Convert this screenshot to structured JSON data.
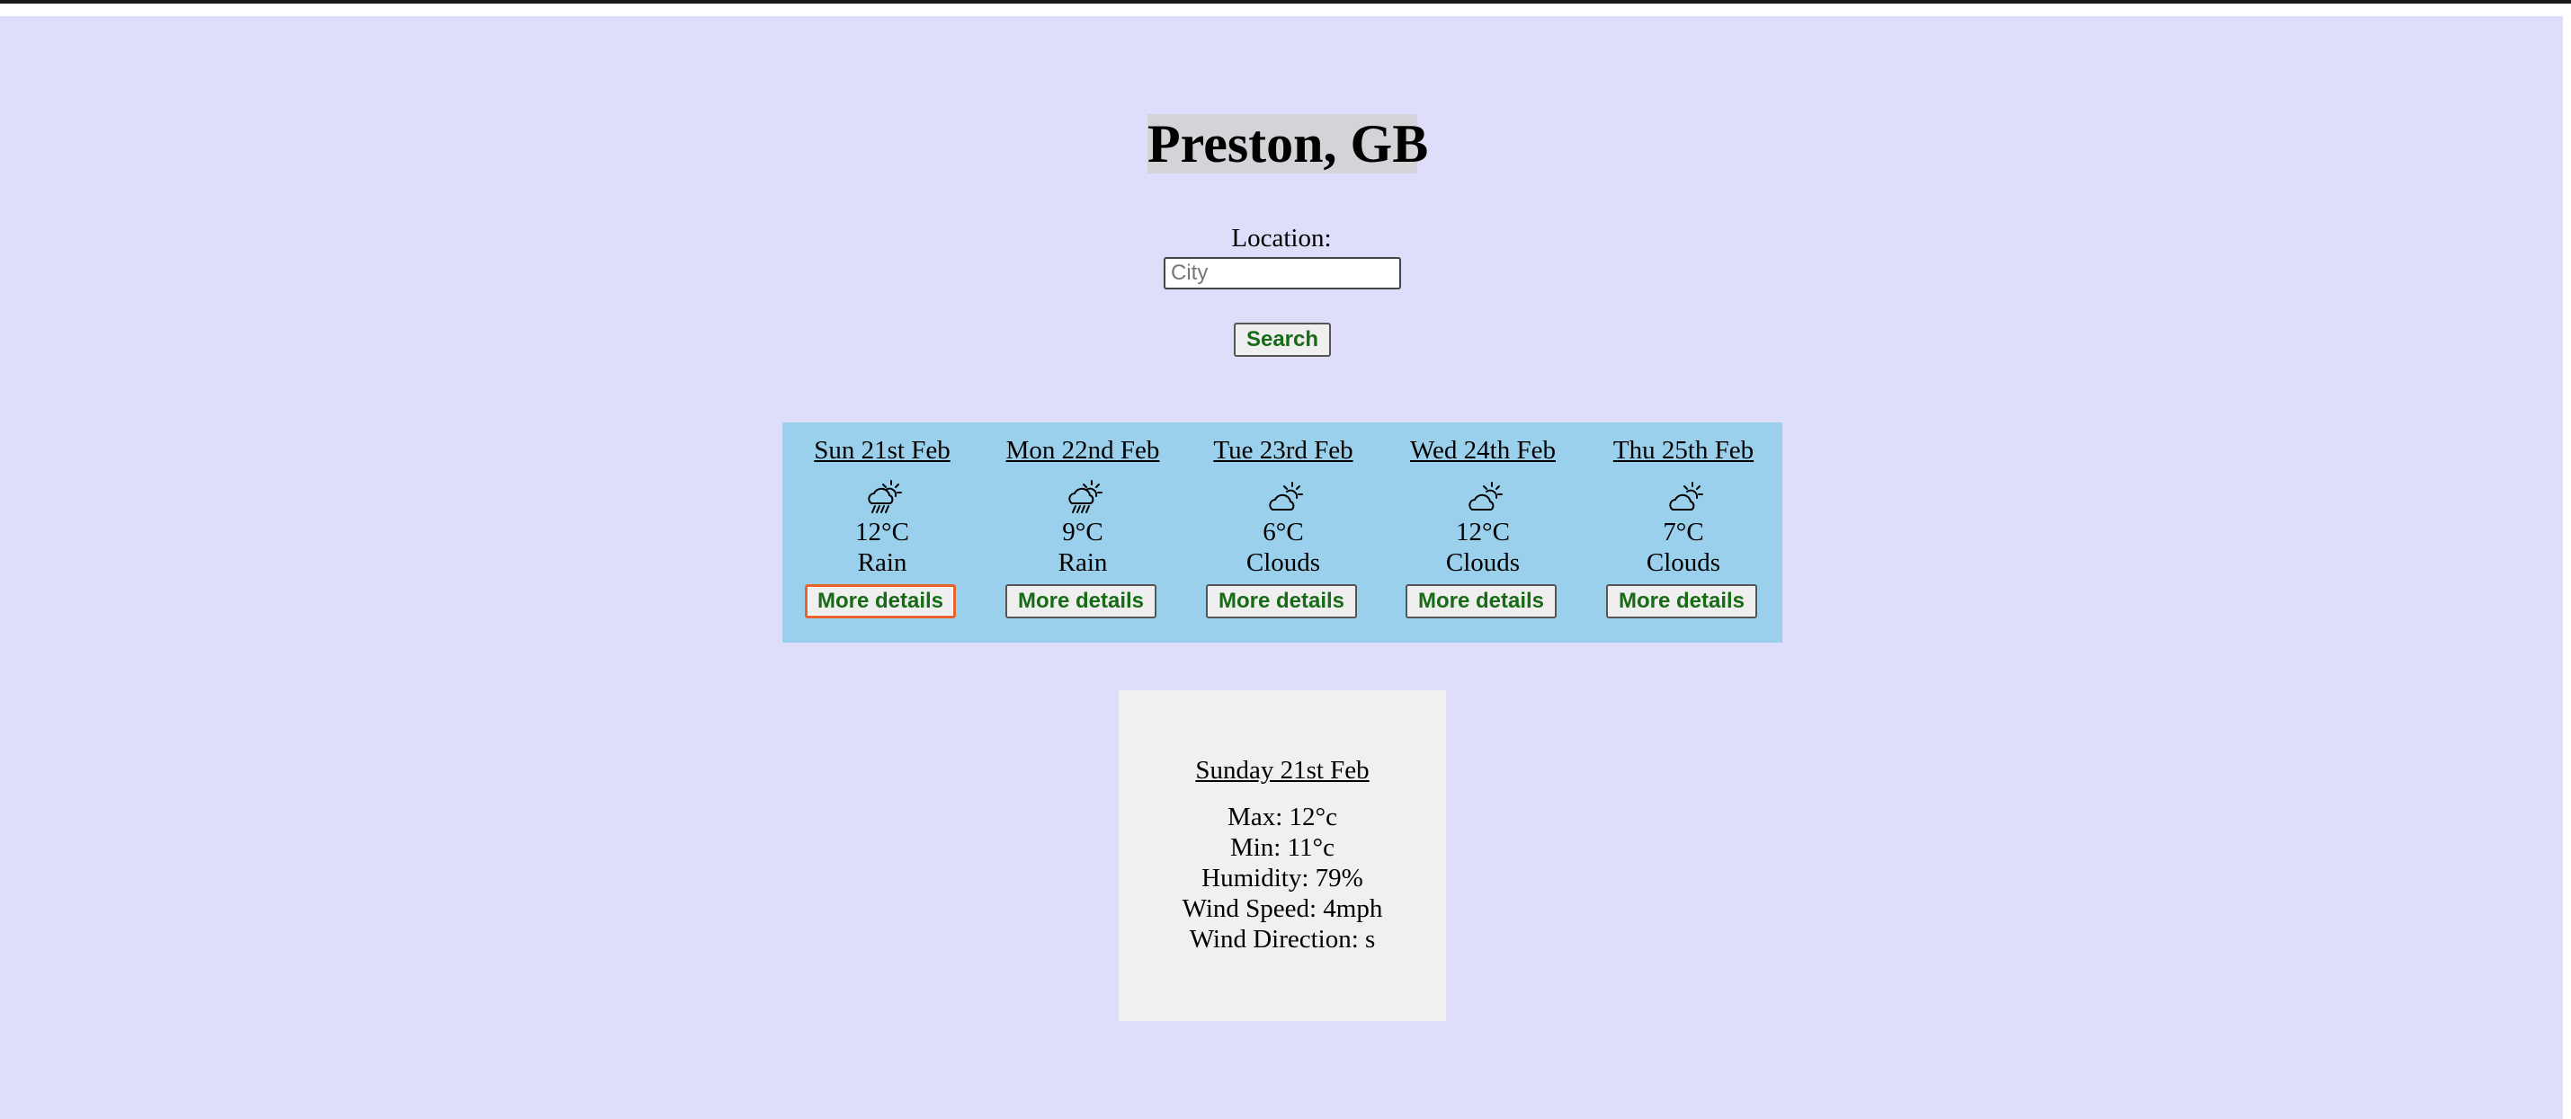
{
  "location_title": "Preston, GB",
  "search": {
    "label": "Location:",
    "placeholder": "City",
    "value": "",
    "button_label": "Search"
  },
  "forecast": [
    {
      "day": "Sun 21st Feb",
      "icon": "rain-sun-icon",
      "temp": "12°C",
      "condition": "Rain",
      "button_label": "More details"
    },
    {
      "day": "Mon 22nd Feb",
      "icon": "rain-sun-icon",
      "temp": "9°C",
      "condition": "Rain",
      "button_label": "More details"
    },
    {
      "day": "Tue 23rd Feb",
      "icon": "cloud-sun-icon",
      "temp": "6°C",
      "condition": "Clouds",
      "button_label": "More details"
    },
    {
      "day": "Wed 24th Feb",
      "icon": "cloud-sun-icon",
      "temp": "12°C",
      "condition": "Clouds",
      "button_label": "More details"
    },
    {
      "day": "Thu 25th Feb",
      "icon": "cloud-sun-icon",
      "temp": "7°C",
      "condition": "Clouds",
      "button_label": "More details"
    }
  ],
  "details": {
    "title": "Sunday 21st Feb",
    "max": "Max: 12°c",
    "min": "Min: 11°c",
    "humidity": "Humidity: 79%",
    "wind_speed": "Wind Speed: 4mph",
    "wind_direction": "Wind Direction: s"
  },
  "colors": {
    "page_background": "#dfdefa",
    "forecast_background": "#9bd0ec",
    "details_background": "#f0f0f0",
    "button_text": "#176b17",
    "focus_outline": "#e8632b"
  }
}
